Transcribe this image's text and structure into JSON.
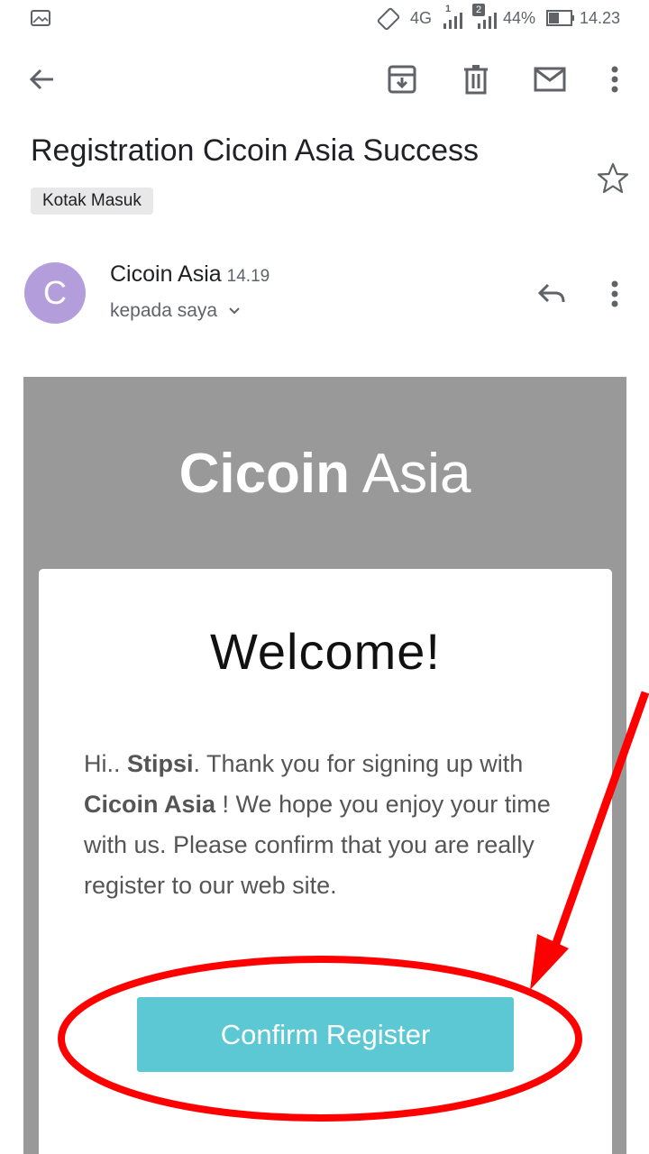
{
  "status_bar": {
    "network": "4G",
    "sim1": "1",
    "sim2": "2",
    "battery": "44%",
    "time": "14.23"
  },
  "appbar": {
    "back_icon": "arrow-back-icon",
    "archive_icon": "archive-icon",
    "delete_icon": "trash-icon",
    "mark_unread_icon": "mail-icon",
    "more_icon": "more-vert-icon"
  },
  "email": {
    "subject": "Registration Cicoin Asia Success",
    "label": "Kotak Masuk",
    "sender": {
      "initial": "C",
      "name": "Cicoin Asia",
      "time": "14.19",
      "recipient": "kepada saya"
    }
  },
  "body": {
    "brand_bold": "Cicoin",
    "brand_light": "Asia",
    "welcome": "Welcome!",
    "p1": "Hi.. ",
    "username": "Stipsi",
    "p2": ". Thank you for signing up with ",
    "company": "Cicoin Asia",
    "p3": " ! We hope you enjoy your time with us. Please confirm that you are really register to our web site.",
    "confirm_label": "Confirm Register"
  },
  "colors": {
    "mail_background": "#999999",
    "button": "#5bc8d4",
    "avatar": "#b39ddb",
    "annotation": "#ff0000"
  }
}
